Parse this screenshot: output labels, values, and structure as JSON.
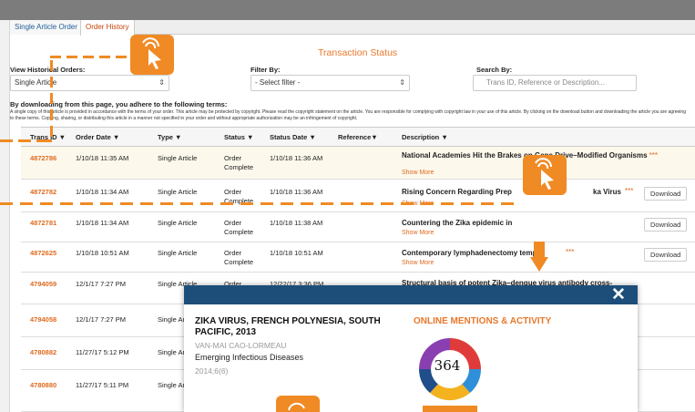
{
  "tabs": [
    "Single Article Order",
    "Order History"
  ],
  "section_title": "Transaction Status",
  "filters": {
    "view_label": "View Historical Orders:",
    "view_value": "Single Article",
    "filter_label": "Filter By:",
    "filter_value": "- Select filter -",
    "search_label": "Search By:",
    "search_placeholder": "Trans ID, Reference or Description..."
  },
  "terms": {
    "heading": "By downloading from this page, you adhere to the following terms:",
    "body": "A single copy of this article is provided in accordance with the terms of your order. This article may be protected by copyright. Please read the copyright statement on the article. You are responsible for complying with copyright law in your use of this article. By clicking on the download button and downloading the article you are agreeing to these terms. Copying, sharing, or distributing this article in a manner not specified in your order and without appropriate authorization may be an infringement of copyright."
  },
  "columns": [
    "Trans ID ▼",
    "Order Date ▼",
    "Type ▼",
    "Status ▼",
    "Status Date ▼",
    "Reference▼",
    "Description ▼"
  ],
  "rows": [
    {
      "id": "4872786",
      "order_date": "1/10/18 11:35 AM",
      "type": "Single Article",
      "status": "Order Complete",
      "status_date": "1/10/18 11:36 AM",
      "desc": "National Academies Hit the Brakes on Gene Drive–Modified Organisms",
      "stars": "***",
      "more": "Show More",
      "download": ""
    },
    {
      "id": "4872782",
      "order_date": "1/10/18 11:34 AM",
      "type": "Single Article",
      "status": "Order Complete",
      "status_date": "1/10/18 11:36 AM",
      "desc": "Rising Concern Regarding Prep",
      "desc2": "ka Virus",
      "stars": "***",
      "more": "Show More",
      "download": "Download"
    },
    {
      "id": "4872781",
      "order_date": "1/10/18 11:34 AM",
      "type": "Single Article",
      "status": "Order Complete",
      "status_date": "1/10/18 11:38 AM",
      "desc": "Countering the Zika epidemic in",
      "stars": "",
      "more": "Show More",
      "download": "Download"
    },
    {
      "id": "4872625",
      "order_date": "1/10/18 10:51 AM",
      "type": "Single Article",
      "status": "Order Complete",
      "status_date": "1/10/18 10:51 AM",
      "desc": "Contemporary lymphadenectomy temp",
      "stars": "***",
      "more": "Show More",
      "download": "Download"
    },
    {
      "id": "4794059",
      "order_date": "12/1/17 7:27 PM",
      "type": "Single Article",
      "status": "Order",
      "status_date": "12/22/17 3:36 PM",
      "desc": "Structural basis of potent Zika–dengue virus antibody cross-",
      "stars": "",
      "more": "",
      "download": ""
    },
    {
      "id": "4794058",
      "order_date": "12/1/17 7:27 PM",
      "type": "Single Ar",
      "status": "",
      "status_date": "",
      "desc": "",
      "stars": "",
      "more": "",
      "download": ""
    },
    {
      "id": "4780882",
      "order_date": "11/27/17 5:12 PM",
      "type": "Single Ar",
      "status": "",
      "status_date": "",
      "desc": "",
      "stars": "",
      "more": "",
      "download": ""
    },
    {
      "id": "4780880",
      "order_date": "11/27/17 5:11 PM",
      "type": "Single Ar",
      "status": "",
      "status_date": "",
      "desc": "",
      "stars": "",
      "more": "",
      "download": ""
    }
  ],
  "modal": {
    "close": "✕",
    "title": "ZIKA VIRUS, FRENCH POLYNESIA, SOUTH PACIFIC, 2013",
    "author": "VAN-MAI CAO-LORMEAU",
    "journal": "Emerging Infectious Diseases",
    "volume": "2014;6(6)",
    "mentions_heading": "ONLINE MENTIONS & ACTIVITY",
    "score": "364"
  },
  "colors": {
    "accent": "#e8782b",
    "link": "#e06a1e",
    "modal_bar": "#1d4e7a"
  }
}
